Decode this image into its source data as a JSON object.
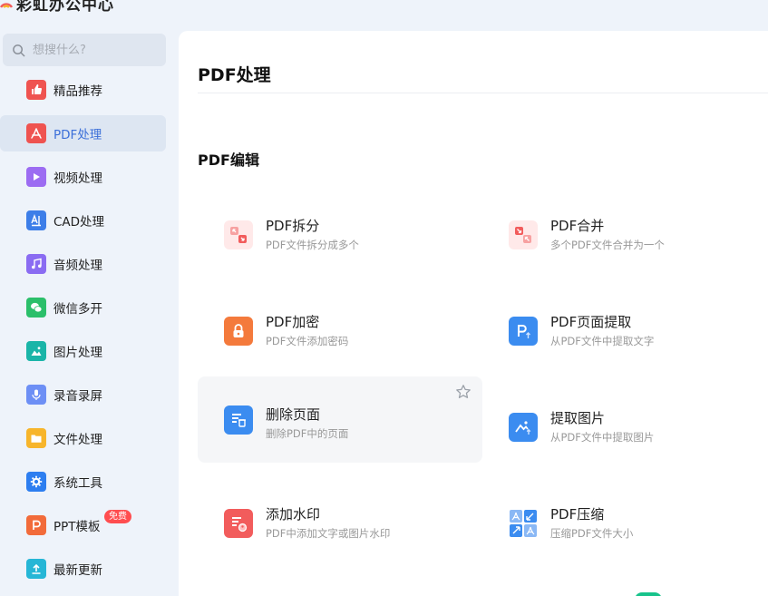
{
  "app": {
    "title": "彩虹办公中心"
  },
  "search": {
    "placeholder": "想搜什么?"
  },
  "sidebar": {
    "items": [
      {
        "label": "精品推荐",
        "icon": "thumbs-up-icon",
        "color": "#ef5350"
      },
      {
        "label": "PDF处理",
        "icon": "pdf-icon",
        "color": "#ef5350",
        "active": true
      },
      {
        "label": "视频处理",
        "icon": "play-icon",
        "color": "#9c6cf2"
      },
      {
        "label": "CAD处理",
        "icon": "cad-icon",
        "color": "#3d7ee8"
      },
      {
        "label": "音频处理",
        "icon": "music-icon",
        "color": "#8a6cf2"
      },
      {
        "label": "微信多开",
        "icon": "wechat-icon",
        "color": "#2bbf6a"
      },
      {
        "label": "图片处理",
        "icon": "image-icon",
        "color": "#1ab5a8"
      },
      {
        "label": "录音录屏",
        "icon": "microphone-icon",
        "color": "#6d8ff5"
      },
      {
        "label": "文件处理",
        "icon": "folder-icon",
        "color": "#f7b52b"
      },
      {
        "label": "系统工具",
        "icon": "gear-icon",
        "color": "#2d7ef0"
      },
      {
        "label": "PPT模板",
        "icon": "ppt-icon",
        "color": "#f26b3a",
        "badge": "免费"
      },
      {
        "label": "最新更新",
        "icon": "upload-icon",
        "color": "#26b6d6"
      }
    ]
  },
  "main": {
    "title": "PDF处理",
    "section": "PDF编辑",
    "tools": [
      {
        "name": "PDF拆分",
        "desc": "PDF文件拆分成多个",
        "icon": "split-icon",
        "color": "#f25c5c"
      },
      {
        "name": "PDF合并",
        "desc": "多个PDF文件合并为一个",
        "icon": "merge-icon",
        "color": "#f25c5c"
      },
      {
        "name": "PDF加密",
        "desc": "PDF文件添加密码",
        "icon": "lock-icon",
        "color": "#f47a3c"
      },
      {
        "name": "PDF页面提取",
        "desc": "从PDF文件中提取文字",
        "icon": "extract-page-icon",
        "color": "#3b8cf0"
      },
      {
        "name": "删除页面",
        "desc": "删除PDF中的页面",
        "icon": "delete-page-icon",
        "color": "#3b8cf0"
      },
      {
        "name": "提取图片",
        "desc": "从PDF文件中提取图片",
        "icon": "extract-image-icon",
        "color": "#3b8cf0"
      },
      {
        "name": "添加水印",
        "desc": "PDF中添加文字或图片水印",
        "icon": "watermark-icon",
        "color": "#f25c5c"
      },
      {
        "name": "PDF压缩",
        "desc": "压缩PDF文件大小",
        "icon": "compress-icon",
        "color": "#3b8cf0"
      }
    ]
  }
}
